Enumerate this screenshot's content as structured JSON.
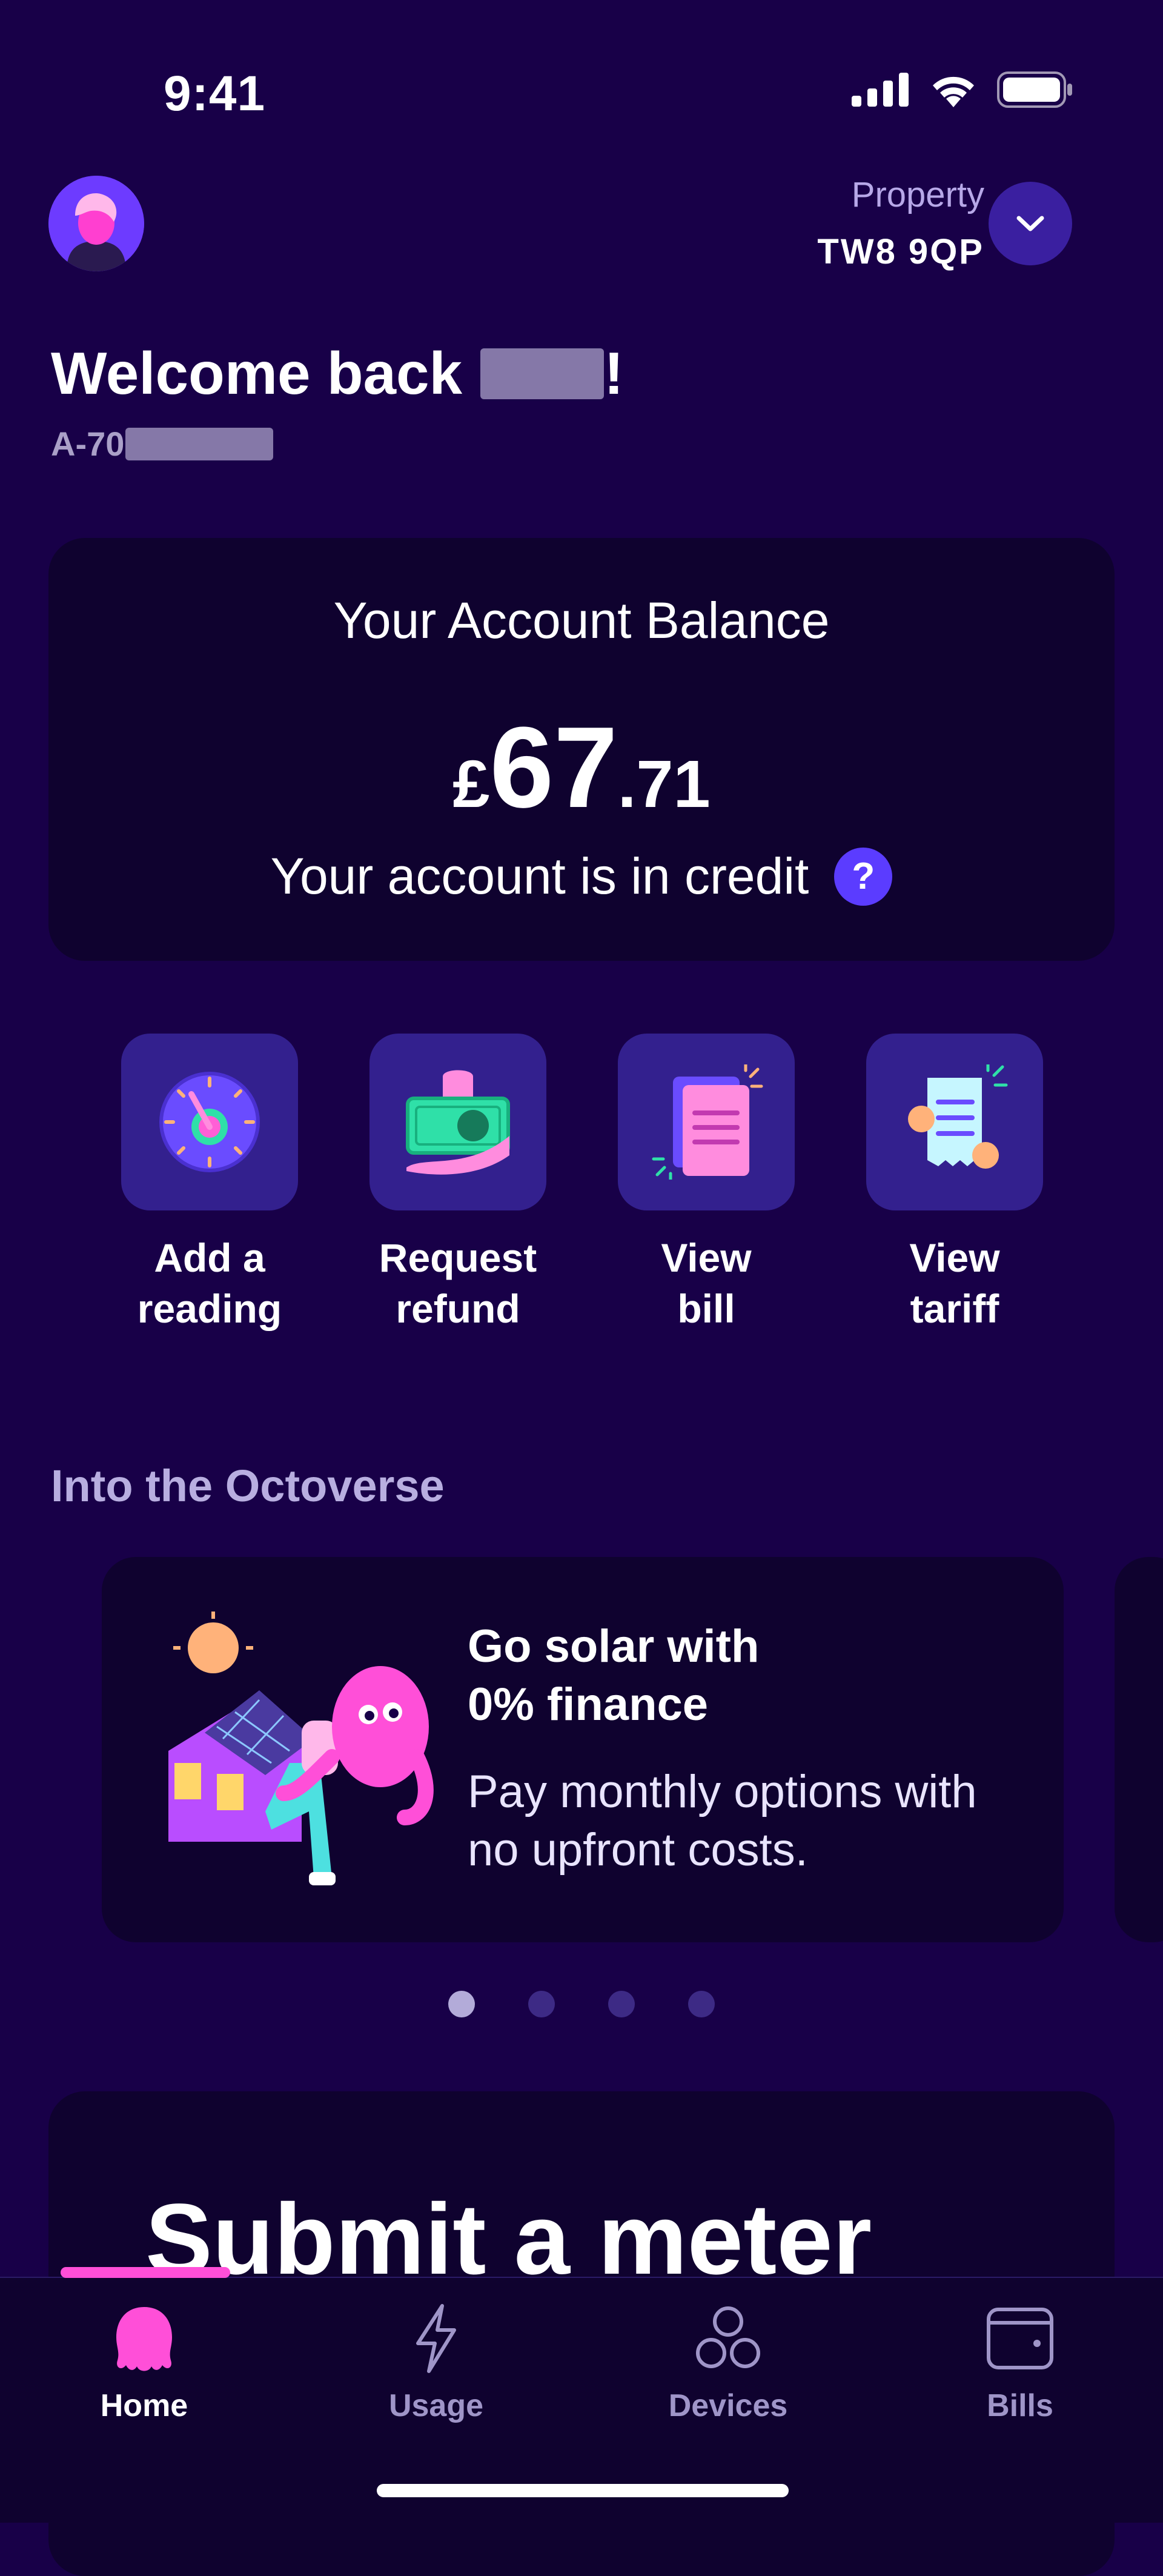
{
  "status_bar": {
    "time": "9:41"
  },
  "header": {
    "property_label": "Property",
    "property_value": "TW8 9QP"
  },
  "welcome": {
    "greeting": "Welcome back",
    "exclaim": "!",
    "account_prefix": "A-70"
  },
  "balance": {
    "title": "Your Account Balance",
    "currency": "£",
    "whole": "67",
    "pence": ".71",
    "status": "Your account is in credit",
    "help": "?"
  },
  "quick_actions": [
    {
      "label": "Add a\nreading",
      "icon": "meter-dial-icon"
    },
    {
      "label": "Request\nrefund",
      "icon": "cash-hand-icon"
    },
    {
      "label": "View\nbill",
      "icon": "bill-document-icon"
    },
    {
      "label": "View\ntariff",
      "icon": "tariff-receipt-icon"
    }
  ],
  "octoverse": {
    "title": "Into the Octoverse",
    "promo_title": "Go solar with\n0% finance",
    "promo_text": "Pay monthly options with no upfront costs.",
    "carousel_pages": 4,
    "carousel_active": 0
  },
  "meter_card": {
    "title": "Submit a meter"
  },
  "nav": {
    "items": [
      {
        "label": "Home",
        "icon": "octopus-icon"
      },
      {
        "label": "Usage",
        "icon": "lightning-icon"
      },
      {
        "label": "Devices",
        "icon": "devices-icon"
      },
      {
        "label": "Bills",
        "icon": "wallet-icon"
      }
    ],
    "active": "Home"
  },
  "colors": {
    "background": "#180048",
    "card": "#0f022f",
    "accent": "#ff4fd8",
    "tile": "#33208e"
  }
}
